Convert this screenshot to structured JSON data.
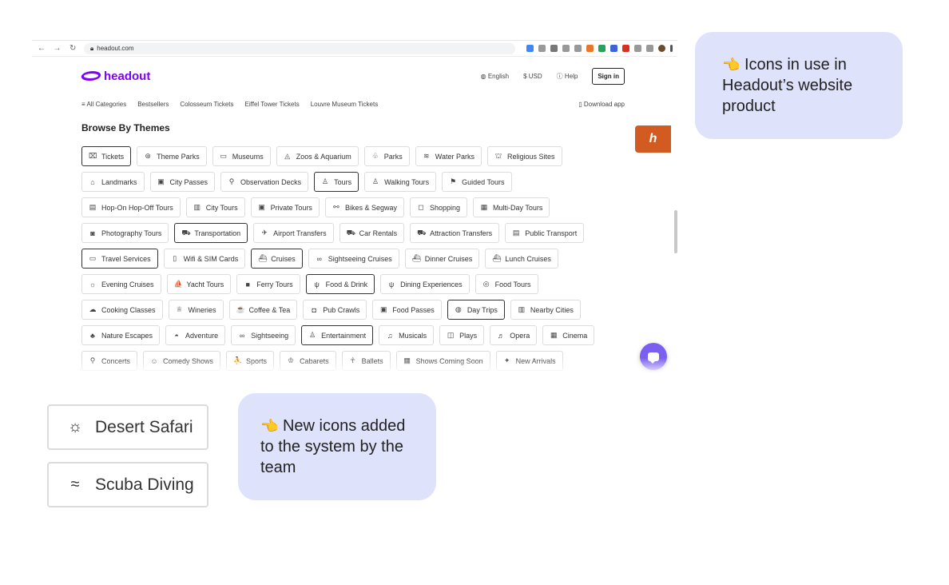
{
  "browser": {
    "url": "headout.com",
    "nav_icons": [
      "back-arrow-icon",
      "forward-arrow-icon",
      "reload-icon"
    ]
  },
  "site": {
    "logo_text": "headout",
    "language": "English",
    "currency": "$ USD",
    "help": "Help",
    "signin": "Sign in",
    "subnav": {
      "all_categories": "All Categories",
      "bestsellers": "Bestsellers",
      "colosseum": "Colosseum Tickets",
      "eiffel": "Eiffel Tower Tickets",
      "louvre": "Louvre Museum Tickets",
      "download": "Download app"
    },
    "section_title": "Browse By Themes",
    "badge_letter": "h"
  },
  "chip_rows": [
    [
      {
        "label": "Tickets",
        "icon": "ticket-icon",
        "glyph": "⌧",
        "active": true
      },
      {
        "label": "Theme Parks",
        "icon": "ferris-wheel-icon",
        "glyph": "⊛",
        "active": false
      },
      {
        "label": "Museums",
        "icon": "museum-icon",
        "glyph": "▭",
        "active": false
      },
      {
        "label": "Zoos & Aquarium",
        "icon": "zoo-icon",
        "glyph": "◬",
        "active": false
      },
      {
        "label": "Parks",
        "icon": "park-icon",
        "glyph": "♧",
        "active": false
      },
      {
        "label": "Water Parks",
        "icon": "water-park-icon",
        "glyph": "≋",
        "active": false
      },
      {
        "label": "Religious Sites",
        "icon": "religious-site-icon",
        "glyph": "⛫",
        "active": false
      }
    ],
    [
      {
        "label": "Landmarks",
        "icon": "landmark-icon",
        "glyph": "⌂",
        "active": false
      },
      {
        "label": "City Passes",
        "icon": "city-pass-icon",
        "glyph": "▣",
        "active": false
      },
      {
        "label": "Observation Decks",
        "icon": "observation-deck-icon",
        "glyph": "⚲",
        "active": false
      },
      {
        "label": "Tours",
        "icon": "tour-guide-icon",
        "glyph": "♙",
        "active": true
      },
      {
        "label": "Walking Tours",
        "icon": "walking-icon",
        "glyph": "♙",
        "active": false
      },
      {
        "label": "Guided Tours",
        "icon": "guided-tour-icon",
        "glyph": "⚑",
        "active": false
      }
    ],
    [
      {
        "label": "Hop-On Hop-Off Tours",
        "icon": "bus-icon",
        "glyph": "▤",
        "active": false
      },
      {
        "label": "City Tours",
        "icon": "city-icon",
        "glyph": "▥",
        "active": false
      },
      {
        "label": "Private Tours",
        "icon": "private-tour-icon",
        "glyph": "▣",
        "active": false
      },
      {
        "label": "Bikes & Segway",
        "icon": "bike-icon",
        "glyph": "⚯",
        "active": false
      },
      {
        "label": "Shopping",
        "icon": "shopping-bag-icon",
        "glyph": "◻",
        "active": false
      },
      {
        "label": "Multi-Day Tours",
        "icon": "calendar-icon",
        "glyph": "▦",
        "active": false
      }
    ],
    [
      {
        "label": "Photography Tours",
        "icon": "camera-icon",
        "glyph": "◙",
        "active": false
      },
      {
        "label": "Transportation",
        "icon": "car-icon",
        "glyph": "⛟",
        "active": true
      },
      {
        "label": "Airport Transfers",
        "icon": "airport-icon",
        "glyph": "✈",
        "active": false
      },
      {
        "label": "Car Rentals",
        "icon": "car-rental-icon",
        "glyph": "⛟",
        "active": false
      },
      {
        "label": "Attraction Transfers",
        "icon": "transfer-icon",
        "glyph": "⛟",
        "active": false
      },
      {
        "label": "Public Transport",
        "icon": "train-icon",
        "glyph": "▤",
        "active": false
      }
    ],
    [
      {
        "label": "Travel Services",
        "icon": "suitcase-icon",
        "glyph": "▭",
        "active": true
      },
      {
        "label": "Wifi & SIM Cards",
        "icon": "sim-card-icon",
        "glyph": "▯",
        "active": false
      },
      {
        "label": "Cruises",
        "icon": "ship-icon",
        "glyph": "⛴",
        "active": true
      },
      {
        "label": "Sightseeing Cruises",
        "icon": "binoculars-icon",
        "glyph": "∞",
        "active": false
      },
      {
        "label": "Dinner Cruises",
        "icon": "dinner-cruise-icon",
        "glyph": "⛴",
        "active": false
      },
      {
        "label": "Lunch Cruises",
        "icon": "lunch-cruise-icon",
        "glyph": "⛴",
        "active": false
      }
    ],
    [
      {
        "label": "Evening Cruises",
        "icon": "evening-cruise-icon",
        "glyph": "☼",
        "active": false
      },
      {
        "label": "Yacht Tours",
        "icon": "yacht-icon",
        "glyph": "⛵",
        "active": false
      },
      {
        "label": "Ferry Tours",
        "icon": "ferry-icon",
        "glyph": "■",
        "active": false
      },
      {
        "label": "Food & Drink",
        "icon": "fork-knife-icon",
        "glyph": "ψ",
        "active": true
      },
      {
        "label": "Dining Experiences",
        "icon": "dining-icon",
        "glyph": "ψ",
        "active": false
      },
      {
        "label": "Food Tours",
        "icon": "food-tour-icon",
        "glyph": "◎",
        "active": false
      }
    ],
    [
      {
        "label": "Cooking Classes",
        "icon": "chef-hat-icon",
        "glyph": "☁",
        "active": false
      },
      {
        "label": "Wineries",
        "icon": "wine-glass-icon",
        "glyph": "♕",
        "active": false
      },
      {
        "label": "Coffee & Tea",
        "icon": "coffee-cup-icon",
        "glyph": "☕",
        "active": false
      },
      {
        "label": "Pub Crawls",
        "icon": "beer-mug-icon",
        "glyph": "◘",
        "active": false
      },
      {
        "label": "Food Passes",
        "icon": "food-pass-icon",
        "glyph": "▣",
        "active": false
      },
      {
        "label": "Day Trips",
        "icon": "globe-icon",
        "glyph": "◍",
        "active": true
      },
      {
        "label": "Nearby Cities",
        "icon": "nearby-city-icon",
        "glyph": "▥",
        "active": false
      }
    ],
    [
      {
        "label": "Nature Escapes",
        "icon": "tree-icon",
        "glyph": "♣",
        "active": false
      },
      {
        "label": "Adventure",
        "icon": "helmet-icon",
        "glyph": "◓",
        "active": false
      },
      {
        "label": "Sightseeing",
        "icon": "sightseeing-icon",
        "glyph": "∞",
        "active": false
      },
      {
        "label": "Entertainment",
        "icon": "entertainment-icon",
        "glyph": "♙",
        "active": true
      },
      {
        "label": "Musicals",
        "icon": "music-note-icon",
        "glyph": "♫",
        "active": false
      },
      {
        "label": "Plays",
        "icon": "theatre-mask-icon",
        "glyph": "◫",
        "active": false
      },
      {
        "label": "Opera",
        "icon": "opera-icon",
        "glyph": "♬",
        "active": false
      },
      {
        "label": "Cinema",
        "icon": "film-icon",
        "glyph": "▦",
        "active": false
      }
    ],
    [
      {
        "label": "Concerts",
        "icon": "microphone-icon",
        "glyph": "⚲",
        "active": false
      },
      {
        "label": "Comedy Shows",
        "icon": "comedy-icon",
        "glyph": "☺",
        "active": false
      },
      {
        "label": "Sports",
        "icon": "sports-icon",
        "glyph": "⛹",
        "active": false
      },
      {
        "label": "Cabarets",
        "icon": "cabaret-icon",
        "glyph": "♔",
        "active": false
      },
      {
        "label": "Ballets",
        "icon": "ballet-icon",
        "glyph": "☥",
        "active": false
      },
      {
        "label": "Shows Coming Soon",
        "icon": "calendar-icon",
        "glyph": "▦",
        "active": false
      },
      {
        "label": "New Arrivals",
        "icon": "sparkle-icon",
        "glyph": "✦",
        "active": false
      }
    ]
  ],
  "callouts": {
    "first": "Icons in use in Headout’s website product",
    "second": "New icons added to the system by the team",
    "pointer_icon": "pointing-hand-icon",
    "pointer_glyph": "👈"
  },
  "new_icons": [
    {
      "label": "Desert Safari",
      "icon": "desert-safari-icon",
      "glyph": "☼"
    },
    {
      "label": "Scuba Diving",
      "icon": "scuba-diving-icon",
      "glyph": "≈"
    }
  ],
  "colors": {
    "brand": "#8000ff",
    "callout_bg": "#dfe2fb",
    "badge": "#d25b21",
    "chat": "#7b5ff0"
  }
}
